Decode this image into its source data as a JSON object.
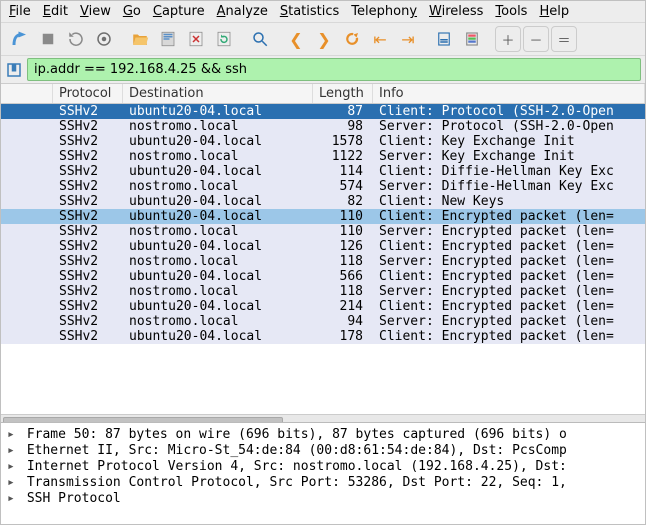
{
  "menu": {
    "file": "File",
    "edit": "Edit",
    "view": "View",
    "go": "Go",
    "capture": "Capture",
    "analyze": "Analyze",
    "statistics": "Statistics",
    "telephony": "Telephony",
    "wireless": "Wireless",
    "tools": "Tools",
    "help": "Help"
  },
  "filter": {
    "value": "ip.addr == 192.168.4.25 && ssh"
  },
  "columns": {
    "protocol": "Protocol",
    "destination": "Destination",
    "length": "Length",
    "info": "Info"
  },
  "packets": [
    {
      "protocol": "SSHv2",
      "destination": "ubuntu20-04.local",
      "length": "87",
      "info": "Client: Protocol (SSH-2.0-Open",
      "sel": "dark"
    },
    {
      "protocol": "SSHv2",
      "destination": "nostromo.local",
      "length": "98",
      "info": "Server: Protocol (SSH-2.0-Open"
    },
    {
      "protocol": "SSHv2",
      "destination": "ubuntu20-04.local",
      "length": "1578",
      "info": "Client: Key Exchange Init"
    },
    {
      "protocol": "SSHv2",
      "destination": "nostromo.local",
      "length": "1122",
      "info": "Server: Key Exchange Init"
    },
    {
      "protocol": "SSHv2",
      "destination": "ubuntu20-04.local",
      "length": "114",
      "info": "Client: Diffie-Hellman Key Exc"
    },
    {
      "protocol": "SSHv2",
      "destination": "nostromo.local",
      "length": "574",
      "info": "Server: Diffie-Hellman Key Exc"
    },
    {
      "protocol": "SSHv2",
      "destination": "ubuntu20-04.local",
      "length": "82",
      "info": "Client: New Keys"
    },
    {
      "protocol": "SSHv2",
      "destination": "ubuntu20-04.local",
      "length": "110",
      "info": "Client: Encrypted packet (len=",
      "sel": "light"
    },
    {
      "protocol": "SSHv2",
      "destination": "nostromo.local",
      "length": "110",
      "info": "Server: Encrypted packet (len="
    },
    {
      "protocol": "SSHv2",
      "destination": "ubuntu20-04.local",
      "length": "126",
      "info": "Client: Encrypted packet (len="
    },
    {
      "protocol": "SSHv2",
      "destination": "nostromo.local",
      "length": "118",
      "info": "Server: Encrypted packet (len="
    },
    {
      "protocol": "SSHv2",
      "destination": "ubuntu20-04.local",
      "length": "566",
      "info": "Client: Encrypted packet (len="
    },
    {
      "protocol": "SSHv2",
      "destination": "nostromo.local",
      "length": "118",
      "info": "Server: Encrypted packet (len="
    },
    {
      "protocol": "SSHv2",
      "destination": "ubuntu20-04.local",
      "length": "214",
      "info": "Client: Encrypted packet (len="
    },
    {
      "protocol": "SSHv2",
      "destination": "nostromo.local",
      "length": "94",
      "info": "Server: Encrypted packet (len="
    },
    {
      "protocol": "SSHv2",
      "destination": "ubuntu20-04.local",
      "length": "178",
      "info": "Client: Encrypted packet (len="
    }
  ],
  "details": [
    "Frame 50: 87 bytes on wire (696 bits), 87 bytes captured (696 bits) o",
    "Ethernet II, Src: Micro-St_54:de:84 (00:d8:61:54:de:84), Dst: PcsComp",
    "Internet Protocol Version 4, Src: nostromo.local (192.168.4.25), Dst:",
    "Transmission Control Protocol, Src Port: 53286, Dst Port: 22, Seq: 1,",
    "SSH Protocol"
  ]
}
